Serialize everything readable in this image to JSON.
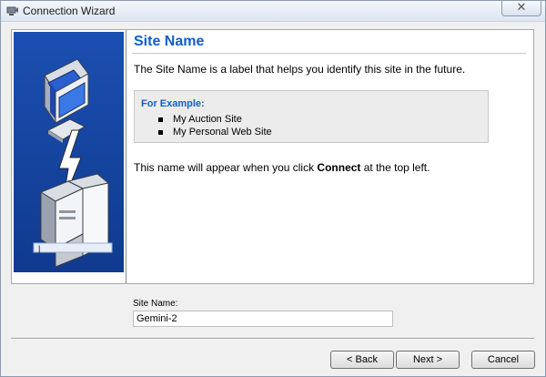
{
  "window": {
    "title": "Connection Wizard",
    "close_symbol": "✕",
    "app_icon": "connection-icon"
  },
  "side_panel": {
    "illustration": "computers-connection-illustration",
    "caption": "|"
  },
  "main": {
    "heading": "Site Name",
    "description": "The Site Name is a label that helps you identify this site in the future.",
    "example_title": "For Example:",
    "examples": [
      "My Auction Site",
      "My Personal Web Site"
    ],
    "note_prefix": "This name will appear when you click ",
    "note_bold": "Connect",
    "note_suffix": " at the top left."
  },
  "form": {
    "site_name_label": "Site Name:",
    "site_name_value": "Gemini-2"
  },
  "buttons": {
    "back": "< Back",
    "next": "Next >",
    "cancel": "Cancel"
  },
  "colors": {
    "heading": "#0f5fc8",
    "side_panel": "#1c4fb2"
  }
}
